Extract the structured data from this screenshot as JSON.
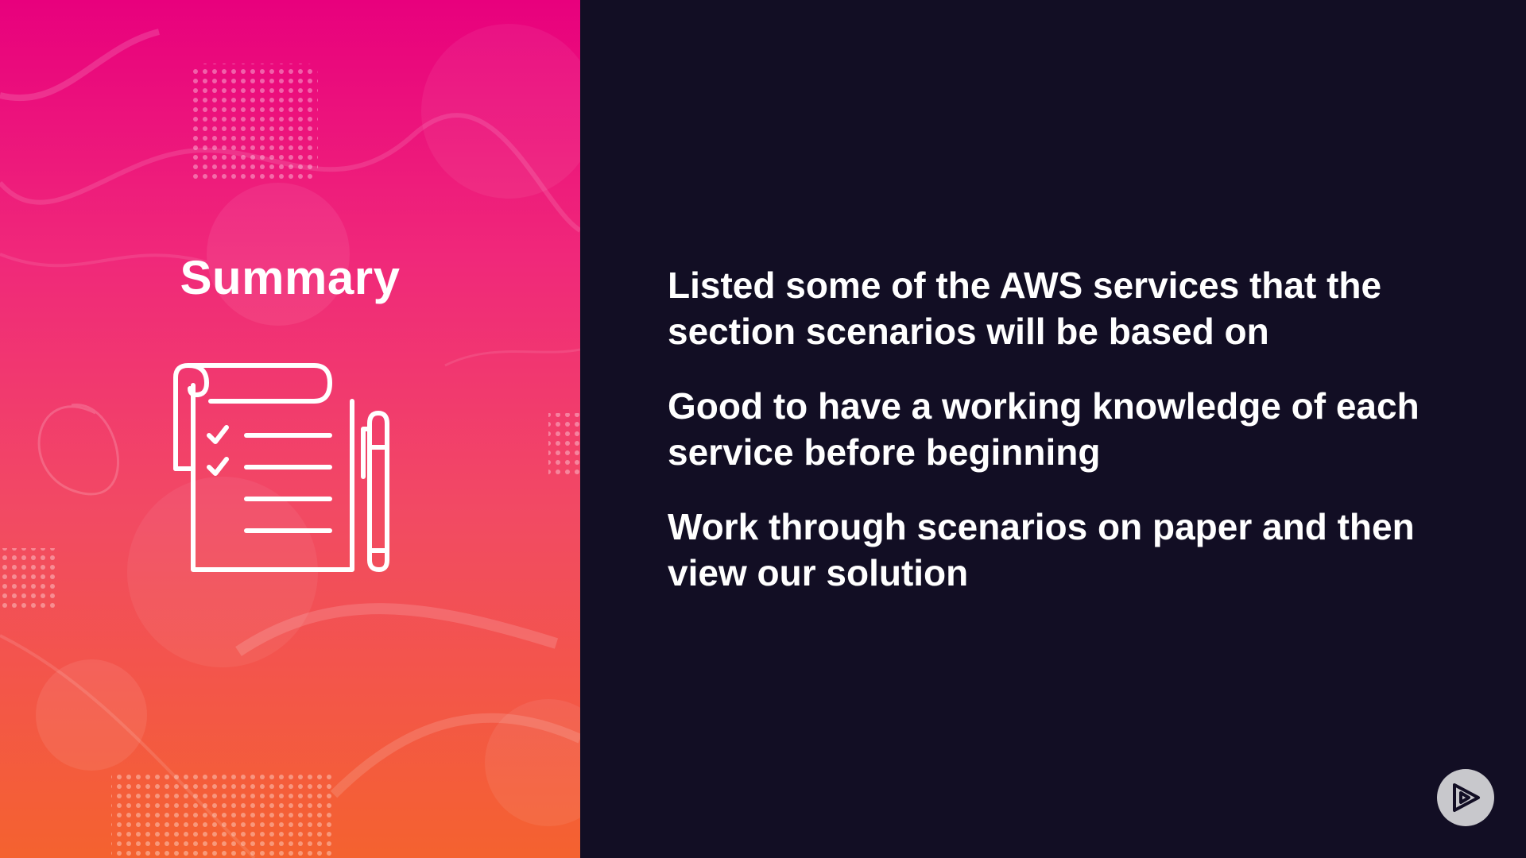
{
  "slide": {
    "title": "Summary",
    "bullets": [
      "Listed some of the AWS services that the section scenarios will be based on",
      "Good to have a working knowledge of each service before beginning",
      "Work through scenarios on paper and then view our solution"
    ]
  },
  "icons": {
    "illustration": "checklist-icon",
    "logo": "play-logo-icon"
  },
  "colors": {
    "background": "#120e24",
    "gradient_top": "#e8007d",
    "gradient_bottom": "#f4622f",
    "text": "#ffffff",
    "logo_bg": "#c8c8cc"
  }
}
